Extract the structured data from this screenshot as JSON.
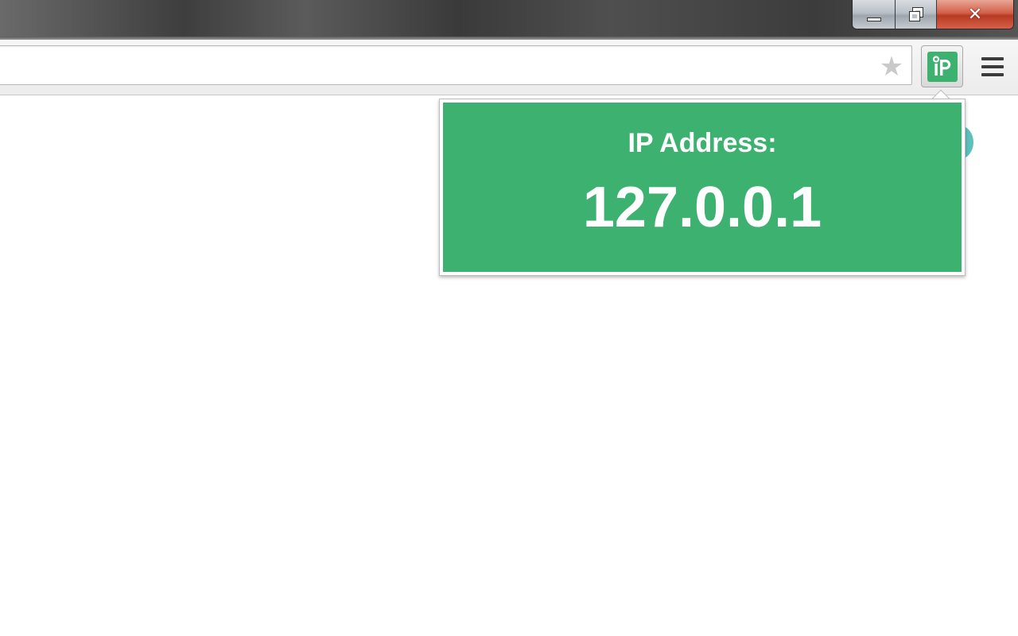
{
  "window": {
    "controls": {
      "minimize_icon": "minimize-icon",
      "restore_icon": "restore-icon",
      "close_label": "✕"
    }
  },
  "toolbar": {
    "bookmark_icon": "star-icon",
    "bookmark_glyph": "★",
    "extension_icon": "ip-extension-icon",
    "menu_icon": "hamburger-menu-icon"
  },
  "popup": {
    "label": "IP Address:",
    "ip": "127.0.0.1"
  },
  "colors": {
    "accent_green": "#3db16f",
    "close_red": "#c9452c",
    "popup_text": "#ffffff"
  }
}
